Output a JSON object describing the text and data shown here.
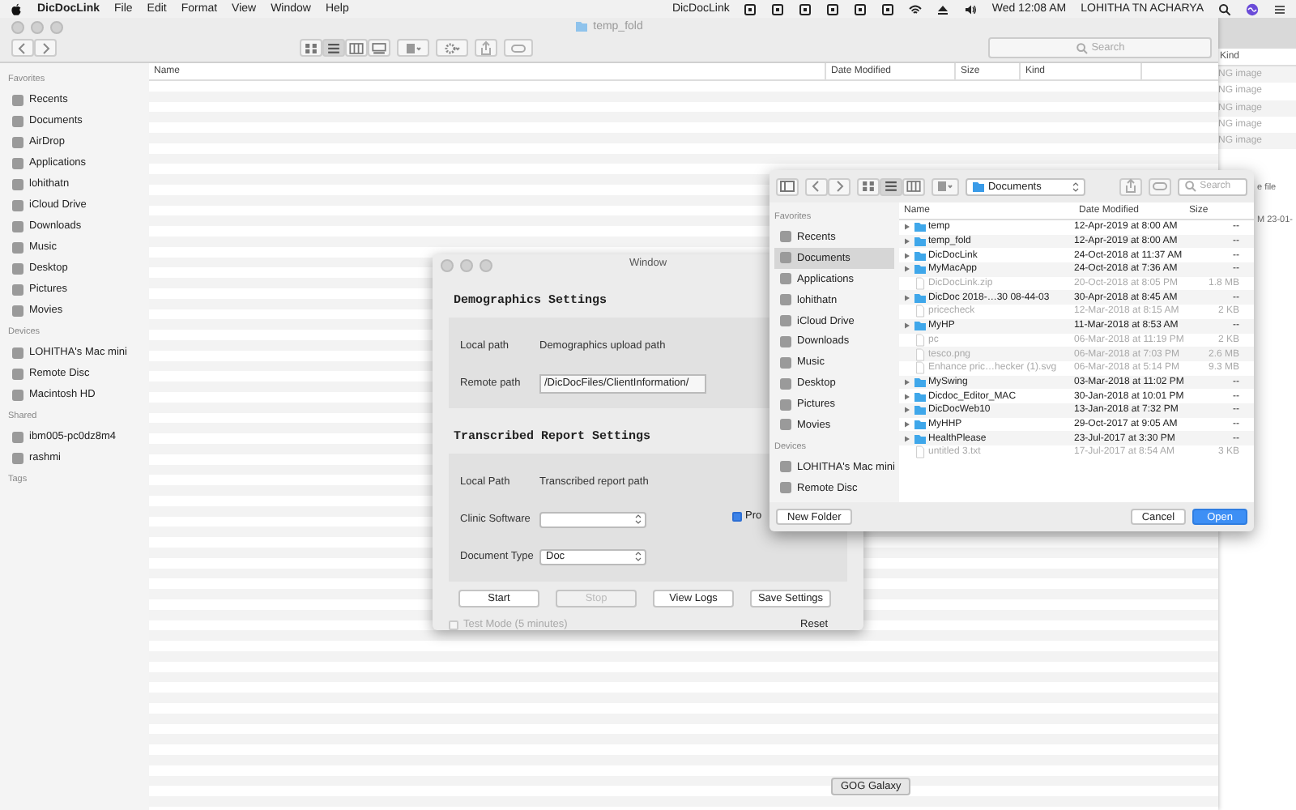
{
  "menu_bar": {
    "app_name": "DicDocLink",
    "menus": [
      "File",
      "Edit",
      "Format",
      "View",
      "Window",
      "Help"
    ],
    "status_app": "DicDocLink",
    "clock": "Wed 12:08 AM",
    "user": "LOHITHA TN ACHARYA"
  },
  "finder": {
    "title": "temp_fold",
    "search_placeholder": "Search",
    "view_buttons": [
      {
        "kind": "icons",
        "selected": false
      },
      {
        "kind": "list",
        "selected": true
      },
      {
        "kind": "columns",
        "selected": false
      },
      {
        "kind": "gallery",
        "selected": false
      }
    ],
    "sidebar": [
      {
        "heading": "Favorites",
        "items": [
          "Recents",
          "Documents",
          "AirDrop",
          "Applications",
          "lohithatn",
          "iCloud Drive",
          "Downloads",
          "Music",
          "Desktop",
          "Pictures",
          "Movies"
        ]
      },
      {
        "heading": "Devices",
        "items": [
          "LOHITHA's Mac mini",
          "Remote Disc",
          "Macintosh HD"
        ]
      },
      {
        "heading": "Shared",
        "items": [
          "ibm005-pc0dz8m4",
          "rashmi"
        ]
      },
      {
        "heading": "Tags"
      }
    ],
    "columns": [
      "Name",
      "Date Modified",
      "Size",
      "Kind"
    ]
  },
  "back_window": {
    "column": "Kind",
    "rows": [
      "NG image",
      "NG image",
      "NG image",
      "NG image",
      "NG image"
    ],
    "text_1": "e file",
    "text_2": "M 23-01-"
  },
  "settings_window": {
    "title": "Window",
    "sections": [
      {
        "heading": "Demographics Settings",
        "rows": [
          {
            "kind": "text",
            "label": "Local path",
            "value": "Demographics upload path"
          },
          {
            "kind": "field",
            "label": "Remote path",
            "value": "/DicDocFiles/ClientInformation/"
          }
        ]
      },
      {
        "heading": "Transcribed Report Settings",
        "rows": [
          {
            "kind": "text",
            "label": "Local Path",
            "value": "Transcribed report path"
          },
          {
            "kind": "popup",
            "label": "Clinic Software"
          },
          {
            "kind": "popup",
            "label": "Document Type",
            "value": "Doc"
          }
        ]
      }
    ],
    "side_checkbox": {
      "label": "Pro",
      "checked": true
    },
    "buttons": [
      {
        "label": "Start",
        "disabled": false
      },
      {
        "label": "Stop",
        "disabled": true
      },
      {
        "label": "View Logs",
        "disabled": false
      },
      {
        "label": "Save Settings",
        "disabled": false
      }
    ],
    "test_mode": {
      "label": "Test Mode (5 minutes)",
      "checked": false,
      "disabled": true
    },
    "reset": "Reset"
  },
  "open_dialog": {
    "location": "Documents",
    "search_placeholder": "Search",
    "view_buttons": [
      {
        "kind": "icons",
        "selected": false
      },
      {
        "kind": "list",
        "selected": true
      },
      {
        "kind": "columns",
        "selected": false
      }
    ],
    "sidebar": [
      {
        "heading": "Favorites",
        "items": [
          {
            "label": "Recents",
            "selected": false
          },
          {
            "label": "Documents",
            "selected": true
          },
          {
            "label": "Applications",
            "selected": false
          },
          {
            "label": "lohithatn",
            "selected": false
          },
          {
            "label": "iCloud Drive",
            "selected": false
          },
          {
            "label": "Downloads",
            "selected": false
          },
          {
            "label": "Music",
            "selected": false
          },
          {
            "label": "Desktop",
            "selected": false
          },
          {
            "label": "Pictures",
            "selected": false
          },
          {
            "label": "Movies",
            "selected": false
          }
        ]
      },
      {
        "heading": "Devices",
        "items": [
          {
            "label": "LOHITHA's Mac mini",
            "selected": false
          },
          {
            "label": "Remote Disc",
            "selected": false
          }
        ]
      }
    ],
    "columns": [
      "Name",
      "Date Modified",
      "Size"
    ],
    "rows": [
      {
        "kind": "folder",
        "name": "temp",
        "date": "12-Apr-2019 at 8:00 AM",
        "size": "--"
      },
      {
        "kind": "folder",
        "name": "temp_fold",
        "date": "12-Apr-2019 at 8:00 AM",
        "size": "--"
      },
      {
        "kind": "folder",
        "name": "DicDocLink",
        "date": "24-Oct-2018 at 11:37 AM",
        "size": "--"
      },
      {
        "kind": "folder",
        "name": "MyMacApp",
        "date": "24-Oct-2018 at 7:36 AM",
        "size": "--"
      },
      {
        "kind": "file",
        "name": "DicDocLink.zip",
        "date": "20-Oct-2018 at 8:05 PM",
        "size": "1.8 MB"
      },
      {
        "kind": "folder",
        "name": "DicDoc 2018-…30 08-44-03",
        "date": "30-Apr-2018 at 8:45 AM",
        "size": "--"
      },
      {
        "kind": "file",
        "name": "pricecheck",
        "date": "12-Mar-2018 at 8:15 AM",
        "size": "2 KB"
      },
      {
        "kind": "folder",
        "name": "MyHP",
        "date": "11-Mar-2018 at 8:53 AM",
        "size": "--"
      },
      {
        "kind": "file",
        "name": "pc",
        "date": "06-Mar-2018 at 11:19 PM",
        "size": "2 KB"
      },
      {
        "kind": "file",
        "name": "tesco.png",
        "date": "06-Mar-2018 at 7:03 PM",
        "size": "2.6 MB"
      },
      {
        "kind": "file",
        "name": "Enhance pric…hecker (1).svg",
        "date": "06-Mar-2018 at 5:14 PM",
        "size": "9.3 MB"
      },
      {
        "kind": "folder",
        "name": "MySwing",
        "date": "03-Mar-2018 at 11:02 PM",
        "size": "--"
      },
      {
        "kind": "folder",
        "name": "Dicdoc_Editor_MAC",
        "date": "30-Jan-2018 at 10:01 PM",
        "size": "--"
      },
      {
        "kind": "folder",
        "name": "DicDocWeb10",
        "date": "13-Jan-2018 at 7:32 PM",
        "size": "--"
      },
      {
        "kind": "folder",
        "name": "MyHHP",
        "date": "29-Oct-2017 at 9:05 AM",
        "size": "--"
      },
      {
        "kind": "folder",
        "name": "HealthPlease",
        "date": "23-Jul-2017 at 3:30 PM",
        "size": "--"
      },
      {
        "kind": "file",
        "name": "untitled 3.txt",
        "date": "17-Jul-2017 at 8:54 AM",
        "size": "3 KB"
      }
    ],
    "new_folder": "New Folder",
    "cancel": "Cancel",
    "open": "Open"
  },
  "dock_tooltip": "GOG Galaxy"
}
